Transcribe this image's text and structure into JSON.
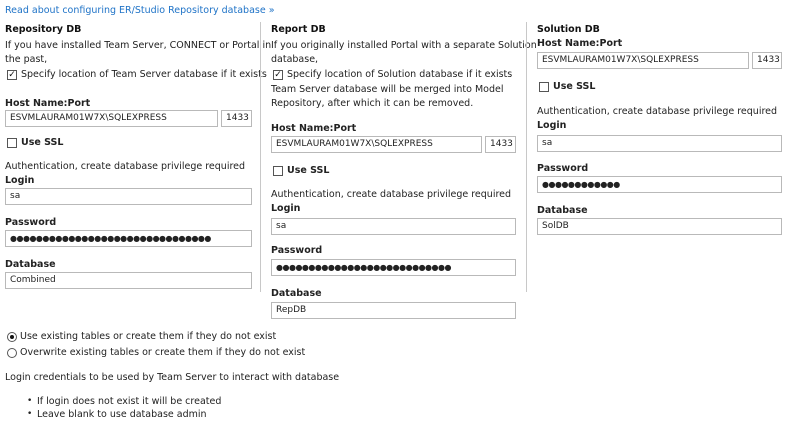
{
  "top_link": "Read about configuring ER/Studio Repository database »",
  "repository": {
    "title": "Repository DB",
    "desc_line1": "If you have installed Team Server, CONNECT or Portal in",
    "desc_line2": "the past,",
    "specify_label": "Specify location of Team Server database if it exists",
    "host_label": "Host Name:Port",
    "host_value": "ESVMLAURAM01W7X\\SQLEXPRESS",
    "port_value": "1433",
    "ssl_label": "Use SSL",
    "auth_text": "Authentication, create database privilege required",
    "login_label": "Login",
    "login_value": "sa",
    "password_label": "Password",
    "password_value": "●●●●●●●●●●●●●●●●●●●●●●●●●●●●●●●",
    "database_label": "Database",
    "database_value": "Combined"
  },
  "report": {
    "title": "Report DB",
    "desc_line1": "If you originally installed Portal with a separate Solution",
    "desc_line2": "database,",
    "specify_label": "Specify location of Solution database if it exists",
    "merge_line1": "Team Server database will be merged into Model",
    "merge_line2": "Repository, after which it can be removed.",
    "host_label": "Host Name:Port",
    "host_value": "ESVMLAURAM01W7X\\SQLEXPRESS",
    "port_value": "1433",
    "ssl_label": "Use SSL",
    "auth_text": "Authentication, create database privilege required",
    "login_label": "Login",
    "login_value": "sa",
    "password_label": "Password",
    "password_value": "●●●●●●●●●●●●●●●●●●●●●●●●●●●",
    "database_label": "Database",
    "database_value": "RepDB"
  },
  "solution": {
    "title": "Solution DB",
    "host_label": "Host Name:Port",
    "host_value": "ESVMLAURAM01W7X\\SQLEXPRESS",
    "port_value": "1433",
    "ssl_label": "Use SSL",
    "auth_text": "Authentication, create database privilege required",
    "login_label": "Login",
    "login_value": "sa",
    "password_label": "Password",
    "password_value": "●●●●●●●●●●●●",
    "database_label": "Database",
    "database_value": "SolDB"
  },
  "options": {
    "use_existing": "Use existing tables or create them if they do not exist",
    "overwrite": "Overwrite existing tables or create them if they do not exist"
  },
  "notes": {
    "credentials": "Login credentials to be used by Team Server to interact with database",
    "bullet1": "If login does not exist it will be created",
    "bullet2": "Leave blank to use database admin"
  }
}
